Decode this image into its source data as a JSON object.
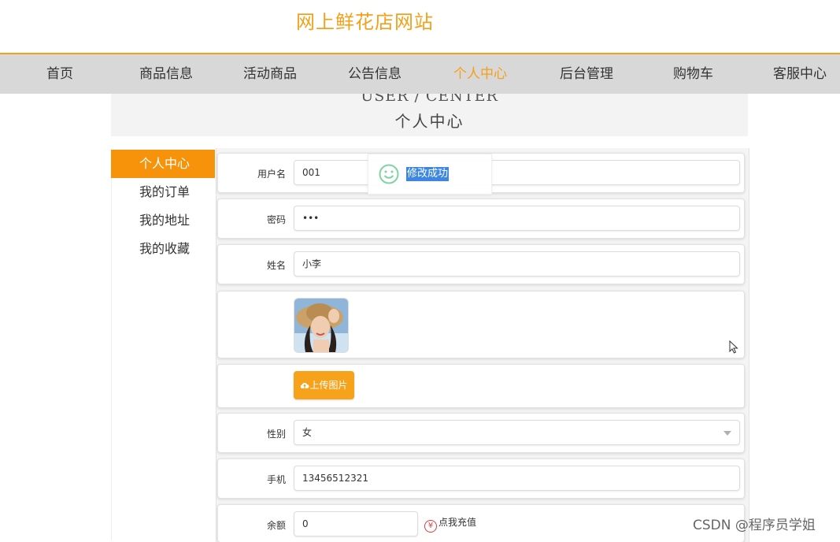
{
  "site_title": "网上鲜花店网站",
  "nav": [
    {
      "label": "首页"
    },
    {
      "label": "商品信息"
    },
    {
      "label": "活动商品"
    },
    {
      "label": "公告信息"
    },
    {
      "label": "个人中心",
      "active": true
    },
    {
      "label": "后台管理"
    },
    {
      "label": "购物车"
    },
    {
      "label": "客服中心"
    }
  ],
  "banner": {
    "en": "USER / CENTER",
    "cn": "个人中心"
  },
  "side_menu": [
    {
      "label": "个人中心",
      "active": true
    },
    {
      "label": "我的订单"
    },
    {
      "label": "我的地址"
    },
    {
      "label": "我的收藏"
    }
  ],
  "form": {
    "username_label": "用户名",
    "username_value": "001",
    "password_label": "密码",
    "password_value": "•••",
    "name_label": "姓名",
    "name_value": "小李",
    "upload_label": "上传图片",
    "gender_label": "性别",
    "gender_value": "女",
    "phone_label": "手机",
    "phone_value": "13456512321",
    "balance_label": "余额",
    "balance_value": "0",
    "recharge_label": "点我充值"
  },
  "toast": {
    "text": "修改成功"
  },
  "watermark": "CSDN @程序员学姐",
  "colors": {
    "accent": "#f5a01a",
    "nav_bg": "#d8d8d8",
    "toast_highlight": "#3d87e0"
  }
}
